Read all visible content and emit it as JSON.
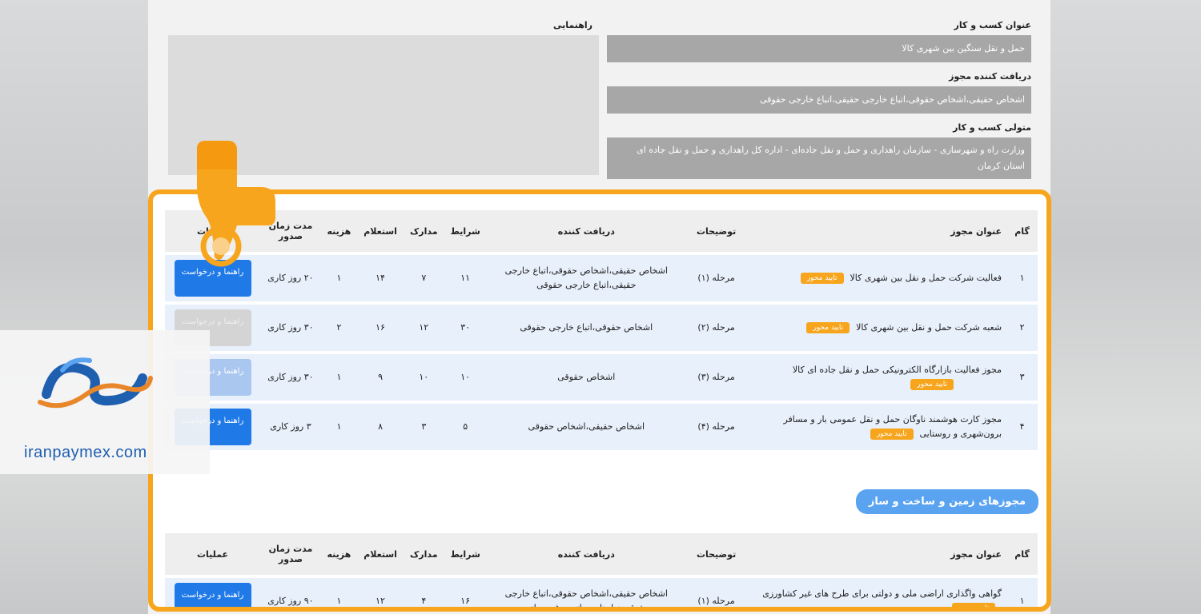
{
  "info": {
    "business_title_label": "عنوان کسب و کار",
    "business_title_value": "حمل و نقل سنگین بین شهری کالا",
    "license_receiver_label": "دریافت کننده مجوز",
    "license_receiver_value": "اشخاص حقیقی،اشخاص حقوقی،اتباع خارجی حقیقی،اتباع خارجی حقوقی",
    "business_trustee_label": "متولی کسب و کار",
    "business_trustee_value": "وزارت راه و شهرسازی - سازمان راهداری و حمل و نقل جاده‌ای - اداره کل راهداری و حمل و نقل جاده ای استان کرمان",
    "guide_label": "راهنمایی"
  },
  "table_headers": {
    "step": "گام",
    "license_title": "عنوان مجوز",
    "description": "توضیحات",
    "receiver": "دریافت کننده",
    "conditions": "شرایط",
    "documents": "مدارک",
    "inquiry": "استعلام",
    "cost": "هزینه",
    "issue_time": "مدت زمان صدور",
    "operations": "عملیات"
  },
  "rows": [
    {
      "step": "۱",
      "title": "فعالیت شرکت حمل و نقل بین شهری کالا",
      "badge": "تایید محور",
      "desc": "مرحله (۱)",
      "receiver": "اشخاص حقیقی،اشخاص حقوقی،اتباع خارجی حقیقی،اتباع خارجی حقوقی",
      "conditions": "۱۱",
      "documents": "۷",
      "inquiry": "۱۴",
      "cost": "۱",
      "time": "۲۰ روز کاری",
      "button": "راهنما و درخواست"
    },
    {
      "step": "۲",
      "title": "شعبه شرکت حمل و نقل بین شهری کالا",
      "badge": "تایید محور",
      "desc": "مرحله (۲)",
      "receiver": "اشخاص حقوقی،اتباع خارجی حقوقی",
      "conditions": "۳۰",
      "documents": "۱۲",
      "inquiry": "۱۶",
      "cost": "۲",
      "time": "۳۰ روز کاری",
      "button": "راهنما و درخواست"
    },
    {
      "step": "۳",
      "title": "مجوز فعالیت بازارگاه الکترونیکی حمل و نقل جاده ای کالا",
      "badge": "تایید محور",
      "desc": "مرحله (۳)",
      "receiver": "اشخاص حقوقی",
      "conditions": "۱۰",
      "documents": "۱۰",
      "inquiry": "۹",
      "cost": "۱",
      "time": "۳۰ روز کاری",
      "button": "راهنما و درخواست"
    },
    {
      "step": "۴",
      "title": "مجوز کارت هوشمند ناوگان حمل و نقل عمومی بار و مسافر برون‌شهری و روستایی",
      "badge": "تایید محور",
      "desc": "مرحله (۴)",
      "receiver": "اشخاص حقیقی،اشخاص حقوقی",
      "conditions": "۵",
      "documents": "۳",
      "inquiry": "۸",
      "cost": "۱",
      "time": "۳ روز کاری",
      "button": "راهنما و درخواست"
    }
  ],
  "section_title": "مجوزهای زمین و ساخت و ساز",
  "rows2": [
    {
      "step": "۱",
      "title": "گواهی واگذاری اراضی ملی و دولتی برای طرح های غیر کشاورزی",
      "badge": "تایید محور",
      "desc": "مرحله (۱)",
      "receiver": "اشخاص حقیقی،اشخاص حقوقی،اتباع خارجی حقوقی،نهادهای دولتی و غیر دولتی",
      "conditions": "۱۶",
      "documents": "۴",
      "inquiry": "۱۲",
      "cost": "۱",
      "time": "۹۰ روز کاری",
      "button": "راهنما و درخواست"
    }
  ],
  "watermark": "iranpaymex.com",
  "colors": {
    "accent": "#f7a51c",
    "primary": "#1f7ae8",
    "row_bg": "#e8f0fb"
  }
}
